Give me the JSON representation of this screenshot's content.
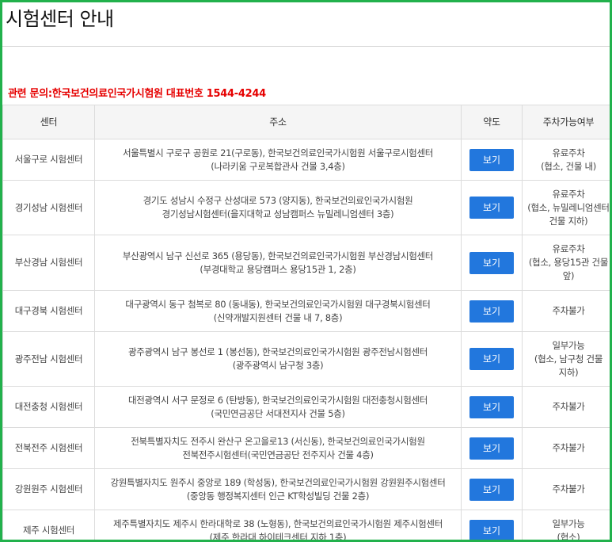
{
  "page": {
    "title": "시험센터 안내",
    "contact": "관련 문의:한국보건의료인국가시험원 대표번호 1544-4244"
  },
  "table": {
    "headers": {
      "center": "센터",
      "address": "주소",
      "map": "약도",
      "parking": "주차가능여부"
    },
    "map_button_label": "보기",
    "map_button_color": "#2277dd",
    "rows": [
      {
        "center": "서울구로 시험센터",
        "address": [
          "서울특별시 구로구 공원로 21(구로동), 한국보건의료인국가시험원 서울구로시험센터",
          "(나라키움 구로복합관사 건물 3,4층)"
        ],
        "parking": [
          "유료주차",
          "(협소, 건물 내)"
        ]
      },
      {
        "center": "경기성남 시험센터",
        "address": [
          "경기도 성남시 수정구 산성대로 573 (양지동), 한국보건의료인국가시험원",
          "경기성남시험센터(을지대학교 성남캠퍼스 뉴밀레니엄센터 3층)"
        ],
        "parking": [
          "유료주차",
          "(협소, 뉴밀레니엄센터",
          "건물 지하)"
        ]
      },
      {
        "center": "부산경남 시험센터",
        "address": [
          "부산광역시 남구 신선로 365 (용당동), 한국보건의료인국가시험원 부산경남시험센터",
          "(부경대학교 용당캠퍼스 용당15관 1, 2층)"
        ],
        "parking": [
          "유료주차",
          "(협소, 용당15관 건물",
          "앞)"
        ]
      },
      {
        "center": "대구경북 시험센터",
        "address": [
          "대구광역시 동구 첨복로 80 (동내동), 한국보건의료인국가시험원 대구경북시험센터",
          "(신약개발지원센터 건물 내 7, 8층)"
        ],
        "parking": [
          "주차불가"
        ]
      },
      {
        "center": "광주전남 시험센터",
        "address": [
          "광주광역시 남구 봉선로 1 (봉선동), 한국보건의료인국가시험원 광주전남시험센터",
          "(광주광역시 남구청 3층)"
        ],
        "parking": [
          "일부가능",
          "(협소, 남구청 건물",
          "지하)"
        ]
      },
      {
        "center": "대전충청 시험센터",
        "address": [
          "대전광역시 서구 문정로 6 (탄방동), 한국보건의료인국가시험원 대전충청시험센터",
          "(국민연금공단 서대전지사 건물 5층)"
        ],
        "parking": [
          "주차불가"
        ]
      },
      {
        "center": "전북전주 시험센터",
        "address": [
          "전북특별자치도 전주시 완산구 온고을로13 (서신동), 한국보건의료인국가시험원",
          "전북전주시험센터(국민연금공단 전주지사 건물 4층)"
        ],
        "parking": [
          "주차불가"
        ]
      },
      {
        "center": "강원원주 시험센터",
        "address": [
          "강원특별자치도 원주시 중앙로 189 (학성동), 한국보건의료인국가시험원 강원원주시험센터",
          "(중앙동 행정복지센터 인근 KT학성빌딩 건물 2층)"
        ],
        "parking": [
          "주차불가"
        ]
      },
      {
        "center": "제주 시험센터",
        "address": [
          "제주특별자치도 제주시 한라대학로 38 (노형동), 한국보건의료인국가시험원 제주시험센터",
          "(제주 한라대 하이테크센터 지하 1층)"
        ],
        "parking": [
          "일부가능",
          "(협소)"
        ]
      }
    ]
  }
}
